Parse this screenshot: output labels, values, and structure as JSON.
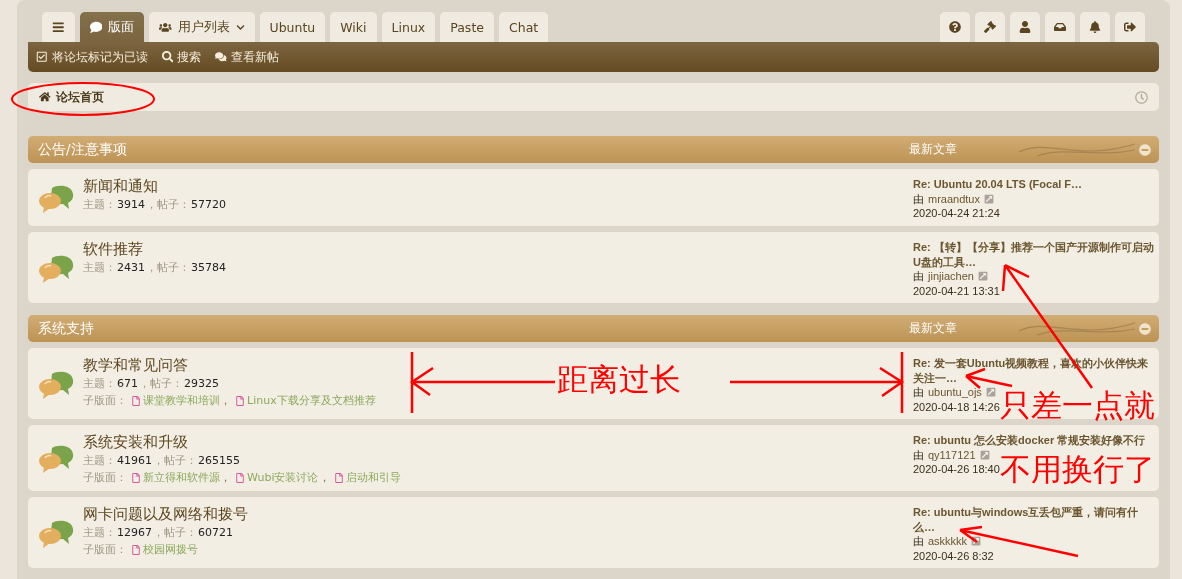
{
  "nav": {
    "tabs": [
      {
        "kind": "menu",
        "selected": false
      },
      {
        "kind": "forum",
        "label": "版面",
        "selected": true
      },
      {
        "kind": "users",
        "label": "用户列表",
        "selected": false
      },
      {
        "kind": "link",
        "label": "Ubuntu",
        "selected": false
      },
      {
        "kind": "link",
        "label": "Wiki",
        "selected": false
      },
      {
        "kind": "link",
        "label": "Linux",
        "selected": false
      },
      {
        "kind": "link",
        "label": "Paste",
        "selected": false
      },
      {
        "kind": "link",
        "label": "Chat",
        "selected": false
      }
    ],
    "icon_tabs": [
      {
        "kind": "help"
      },
      {
        "kind": "gavel"
      },
      {
        "kind": "user"
      },
      {
        "kind": "inbox"
      },
      {
        "kind": "bell"
      },
      {
        "kind": "logout"
      }
    ],
    "quick_links": [
      {
        "kind": "check",
        "label": "将论坛标记为已读"
      },
      {
        "kind": "search",
        "label": "搜索"
      },
      {
        "kind": "comments",
        "label": "查看新帖"
      }
    ]
  },
  "breadcrumb": {
    "label": "论坛首页"
  },
  "categories": [
    {
      "title": "公告/注意事项",
      "last_post_heading": "最新文章",
      "forums": [
        {
          "title": "新闻和通知",
          "topics_label": "主题：",
          "topics": "3914",
          "posts_label": "，帖子：",
          "posts": "57720",
          "last_post": {
            "title": "Re: Ubuntu 20.04 LTS (Focal F…",
            "by": "由",
            "author": "mraandtux",
            "time": "2020-04-24 21:24"
          }
        },
        {
          "title": "软件推荐",
          "topics_label": "主题：",
          "topics": "2431",
          "posts_label": "，帖子：",
          "posts": "35784",
          "last_post": {
            "title": "Re: 【转】【分享】推荐一个国产开源制作可启动U盘的工具…",
            "by": "由",
            "author": "jinjiachen",
            "time": "2020-04-21 13:31"
          }
        }
      ]
    },
    {
      "title": "系统支持",
      "last_post_heading": "最新文章",
      "forums": [
        {
          "title": "教学和常见问答",
          "topics_label": "主题：",
          "topics": "671",
          "posts_label": "，帖子：",
          "posts": "29325",
          "subforums_label": "子版面：",
          "subforums": [
            {
              "name": "课堂教学和培训",
              "separator": "，"
            },
            {
              "name": "Linux下载分享及文档推荐"
            }
          ],
          "last_post": {
            "title": "Re: 发一套Ubuntu视频教程，喜欢的小伙伴快来关注一…",
            "by": "由",
            "author": "ubuntu_ojs",
            "time": "2020-04-18 14:26"
          }
        },
        {
          "title": "系统安装和升级",
          "topics_label": "主题：",
          "topics": "41961",
          "posts_label": "，帖子：",
          "posts": "265155",
          "subforums_label": "子版面：",
          "subforums": [
            {
              "name": "新立得和软件源",
              "separator": "，"
            },
            {
              "name": "Wubi安装讨论",
              "separator": "，"
            },
            {
              "name": "启动和引导"
            }
          ],
          "last_post": {
            "title": "Re: ubuntu 怎么安装docker 常规安装好像不行",
            "by": "由",
            "author": "qy117121",
            "time": "2020-04-26 18:40"
          }
        },
        {
          "title": "网卡问题以及网络和拨号",
          "topics_label": "主题：",
          "topics": "12967",
          "posts_label": "，帖子：",
          "posts": "60721",
          "subforums_label": "子版面：",
          "subforums": [
            {
              "name": "校园网拨号"
            }
          ],
          "last_post": {
            "title": "Re: ubuntu与windows互丢包严重，请问有什么…",
            "by": "由",
            "author": "askkkkk",
            "time": "2020-04-26 8:32"
          }
        }
      ]
    }
  ],
  "annotations": [
    {
      "text": "距离过长"
    },
    {
      "text": "只差一点就"
    },
    {
      "text": "不用换行了"
    }
  ]
}
